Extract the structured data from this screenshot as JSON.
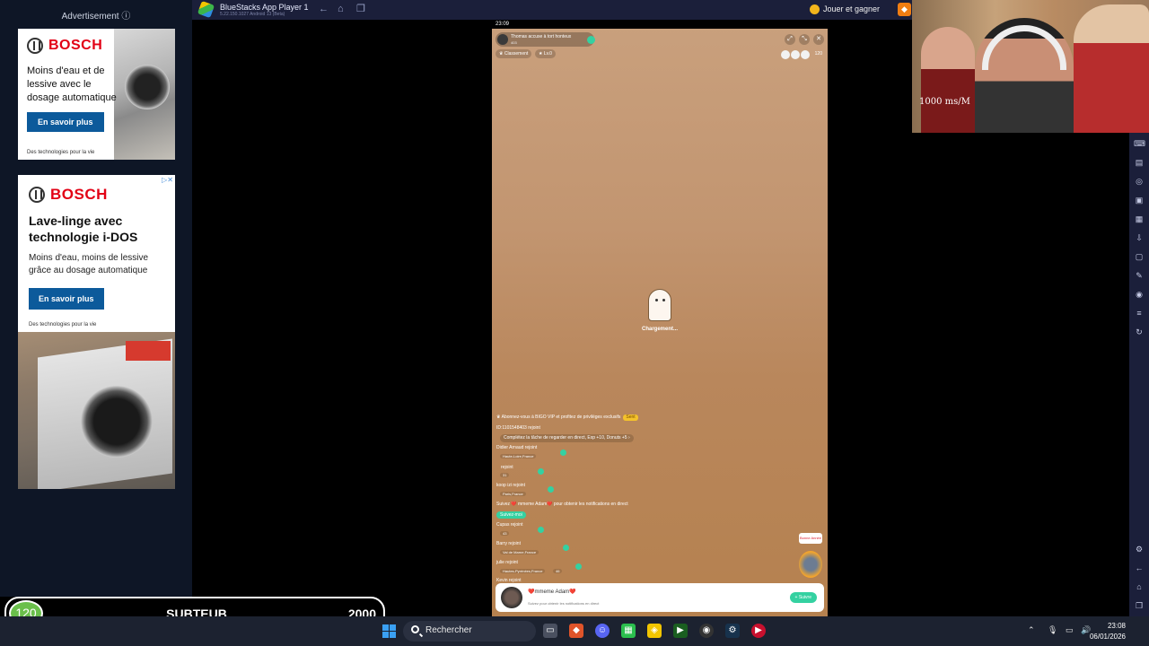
{
  "ads": {
    "label": "Advertisement ⓘ",
    "ad1": {
      "brand": "BOSCH",
      "headline": "Moins d'eau et de lessive avec le dosage automatique",
      "cta": "En savoir plus",
      "footer": "Des technologies pour la vie"
    },
    "ad2": {
      "brand": "BOSCH",
      "headline": "Lave-linge avec technologie i-DOS",
      "sub": "Moins d'eau, moins de lessive grâce au dosage automatique",
      "cta": "En savoir plus",
      "footer": "Des technologies pour la vie"
    }
  },
  "sub_counter": {
    "current": "120",
    "label": "SUBTEUB",
    "goal": "2000"
  },
  "bluestacks": {
    "title": "BlueStacks App Player 1",
    "version": "5.22.150.1027 Android 13 (Beta)",
    "play_earn": "Jouer et gagner"
  },
  "webcam": {
    "overlay_text": "1000 ms/M"
  },
  "phone": {
    "status_time": "23:09",
    "host_name": "Thomas accuse à tort honteux",
    "host_sub": "403",
    "chip_ranking": "Classement",
    "chip_level": "Lv.0",
    "viewer_count": "120",
    "loading_text": "Chargement...",
    "vip_text": "Abonnez-vous à BIGO VIP et profitez de privilèges exclusifs",
    "vip_badge": "Sent",
    "messages": [
      "ID:1101548403 rejoint",
      "Complétez la tâche de regarder en direct, Exp +10, Donuts +5  ›",
      "Didier Arnaud rejoint",
      "rejoint",
      "koop izi rejoint",
      "Suivez ❤️ mmeme Adam❤️ pour obtenir les notifications en direct",
      "Cupas rejoint",
      "Barry rejoint",
      "julie rejoint",
      "Kevin rejoint"
    ],
    "tags": [
      "Haute-Loire,France",
      "31",
      "Paris,France",
      "43",
      "Val de Marne,France",
      "Hautes-Pyrénées,France",
      "46"
    ],
    "follow_me": "Suivez-moi",
    "card_name": "❤️mmeme Adam❤️",
    "card_sub": "Suivez pour obtenir les notifications en direct",
    "card_follow": "+ Suivre",
    "gift_label": "Bonne Année"
  },
  "taskbar": {
    "search_placeholder": "Rechercher",
    "time": "23:08",
    "date": "06/01/2026"
  }
}
